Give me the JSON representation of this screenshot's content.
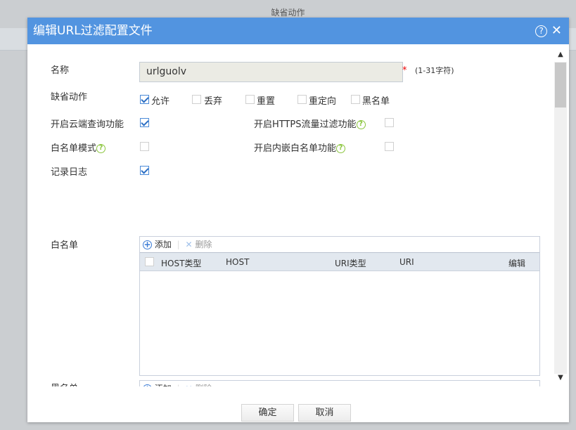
{
  "background": {
    "title": "缺省动作"
  },
  "dialog": {
    "title": "编辑URL过滤配置文件",
    "help_icon": "?",
    "close_icon": "✕"
  },
  "form": {
    "name_label": "名称",
    "name_value": "urlguolv",
    "required_mark": "*",
    "name_hint": "(1-31字符)",
    "default_action_label": "缺省动作",
    "actions": [
      {
        "label": "允许",
        "checked": true
      },
      {
        "label": "丢弃",
        "checked": false
      },
      {
        "label": "重置",
        "checked": false
      },
      {
        "label": "重定向",
        "checked": false
      },
      {
        "label": "黑名单",
        "checked": false
      }
    ],
    "cloud_query_label": "开启云端查询功能",
    "cloud_query_checked": true,
    "https_filter_label": "开启HTTPS流量过滤功能",
    "https_filter_checked": false,
    "whitelist_mode_label": "白名单模式",
    "whitelist_mode_checked": false,
    "embedded_whitelist_label": "开启内嵌白名单功能",
    "embedded_whitelist_checked": false,
    "log_label": "记录日志",
    "log_checked": true
  },
  "whitelist": {
    "label": "白名单",
    "add": "添加",
    "delete": "删除",
    "columns": [
      "HOST类型",
      "HOST",
      "URI类型",
      "URI",
      "编辑"
    ]
  },
  "blacklist": {
    "label": "黑名单",
    "add": "添加",
    "delete": "删除"
  },
  "footer": {
    "ok": "确定",
    "cancel": "取消"
  }
}
